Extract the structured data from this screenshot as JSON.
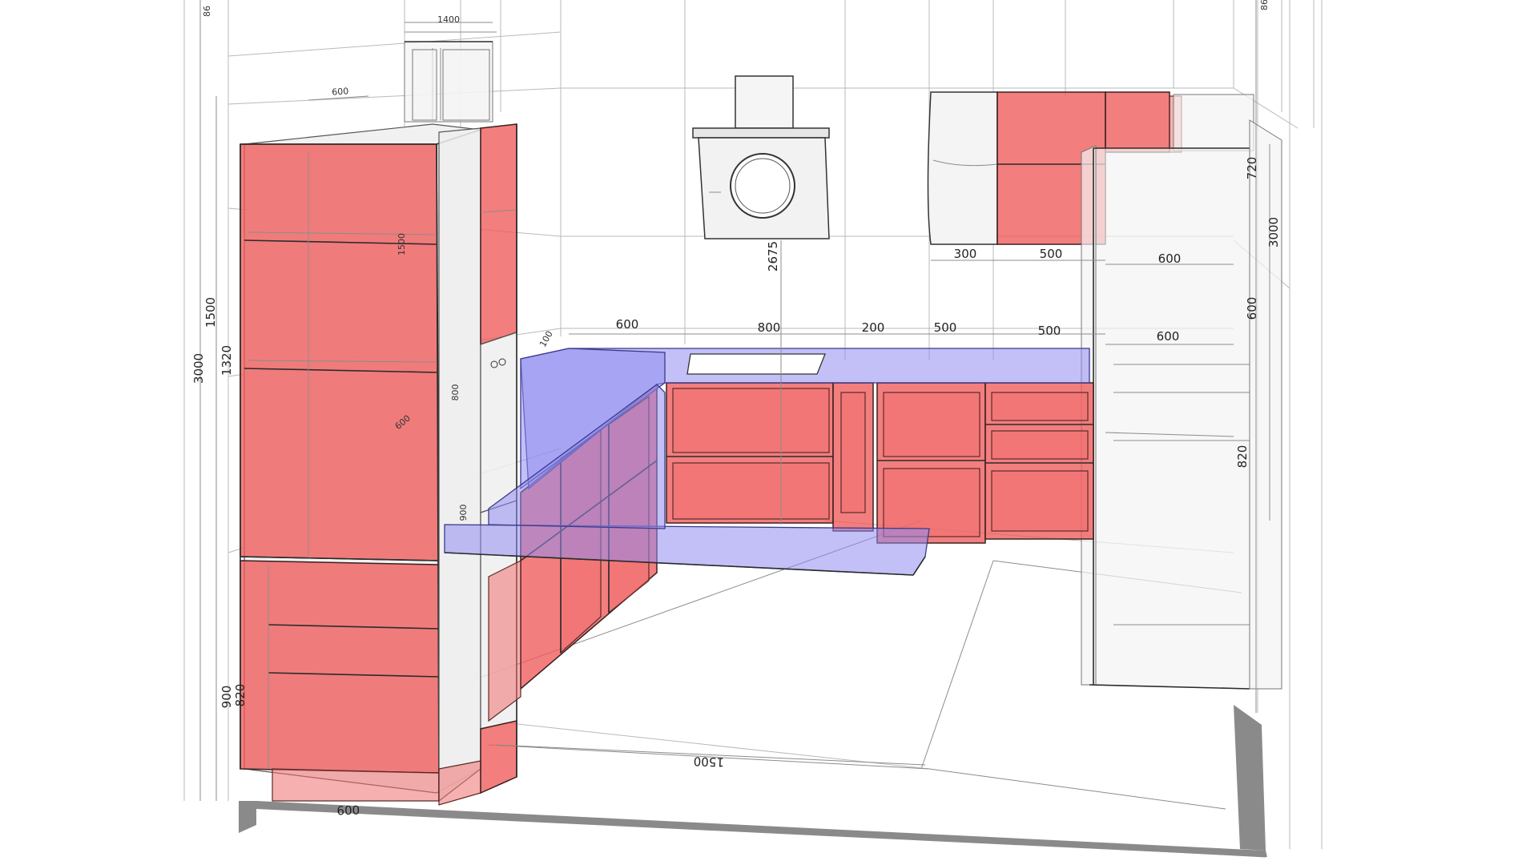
{
  "colors": {
    "cabinet": "#ef5a5a",
    "countertop": "#8f8cf0",
    "appliance": "#eeeeee",
    "lines": "#b9b9b9"
  },
  "dimensions": {
    "top_window_width": "1400",
    "upper_left_600": "600",
    "height_1500_inner": "1500",
    "height_3000": "3000",
    "height_1500": "1500",
    "height_1320": "1320",
    "depth_600_inner": "600",
    "height_800": "800",
    "height_900_inner": "900",
    "height_900": "900",
    "height_820": "820",
    "tall_600_bottom": "600",
    "floor_1500": "1500",
    "hood_2675": "2675",
    "wall_300": "300",
    "wall_500": "500",
    "wall_600": "600",
    "base_600": "600",
    "base_800": "800",
    "base_200": "200",
    "base_500_a": "500",
    "base_500_b": "500",
    "base_600_right": "600",
    "corner_100": "100",
    "right_720": "720",
    "right_3000": "3000",
    "right_600": "600",
    "right_820": "820",
    "top_left_86": "86",
    "top_right_86": "86"
  }
}
